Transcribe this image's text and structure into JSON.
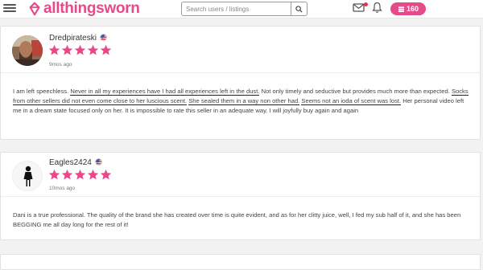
{
  "header": {
    "logo_text": "allthingsworn",
    "brand_color": "#e64a8a",
    "search_placeholder": "Search users / listings",
    "token_count": "160",
    "icons": [
      "menu-icon",
      "logo-icon",
      "search-icon",
      "mail-icon",
      "bell-icon",
      "token-icon"
    ]
  },
  "reviews": [
    {
      "username": "Dredpirateski",
      "flag": "us-flag-icon",
      "rating": 5,
      "time": "9mos ago",
      "text_parts": [
        "I am left speechless. ",
        "Never in all my experiences have I had all experiences left in the dust.",
        " Not only timely and seductive but provides much more than expected. ",
        "Socks from other sellers did not even come close to her luscious scent.",
        " ",
        "She sealed them in a way non other had.",
        " ",
        "Seems not an ioda of scent was lost.",
        " Her personal video left me in a dream state focused only on her. It is impossible to rate this seller in an adequate way. I will joyfully buy again and again"
      ]
    },
    {
      "username": "Eagles2424",
      "flag": "us-flag-icon",
      "rating": 5,
      "time": "10mos ago",
      "text": "Dani is a true professional. The quality of the brand she has created over time is quite evident, and as for her clitty juice, well, I fed my sub half of it, and she has been BEGGING me all day long for the rest of it!"
    }
  ],
  "colors": {
    "star": "#e64a8a",
    "background": "#f2f2f2"
  }
}
